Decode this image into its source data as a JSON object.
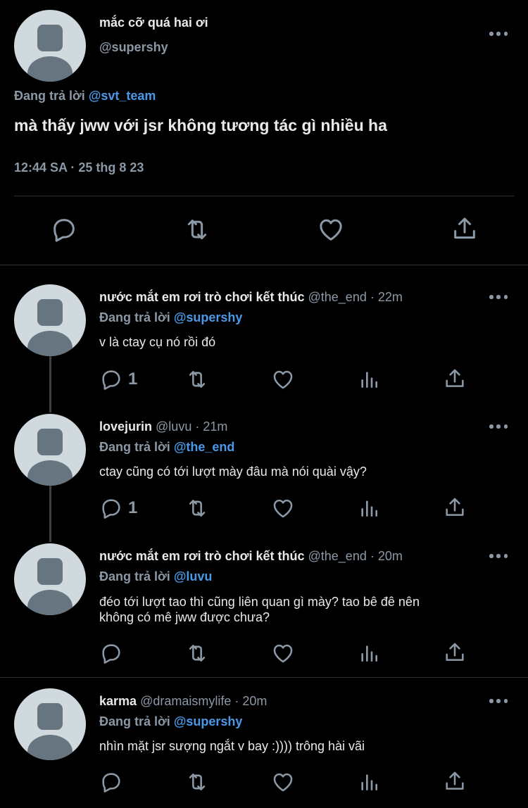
{
  "main_tweet": {
    "display_name": "mắc cỡ quá hai ơi",
    "handle": "@supershy",
    "reply_prefix": "Đang trả lời",
    "reply_to": "@svt_team",
    "text": "mà thấy jww với jsr không tương tác gì nhiều ha",
    "meta": "12:44 SA · 25 thg 8 23"
  },
  "replies": [
    {
      "display_name": "nước mắt em rơi trò chơi kết thúc",
      "handle": "@the_end",
      "time": "· 22m",
      "reply_prefix": "Đang trả lời",
      "reply_to": "@supershy",
      "text": "v là ctay cụ nó rồi đó",
      "reply_count": "1"
    },
    {
      "display_name": "lovejurin",
      "handle": "@luvu",
      "time": "· 21m",
      "reply_prefix": "Đang trả lời",
      "reply_to": "@the_end",
      "text": "ctay cũng có tới lượt mày đâu mà nói quài vậy?",
      "reply_count": "1"
    },
    {
      "display_name": "nước mắt em rơi trò chơi kết thúc",
      "handle": "@the_end",
      "time": "· 20m",
      "reply_prefix": "Đang trả lời",
      "reply_to": "@luvu",
      "text_line1": "đéo tới lượt tao thì cũng liên quan gì mày? tao bê đê nên",
      "text_line2": "không có mê jww được chưa?",
      "reply_count": ""
    },
    {
      "display_name": "karma",
      "handle": "@dramaismylife",
      "time": "· 20m",
      "reply_prefix": "Đang trả lời",
      "reply_to": "@supershy",
      "text": "nhìn mặt jsr sượng ngắt v bay :)))) trông hài vãi",
      "reply_count": ""
    }
  ],
  "icons": {
    "reply": "reply-icon",
    "retweet": "retweet-icon",
    "like": "heart-icon",
    "views": "views-icon",
    "share": "share-icon",
    "more": "more-icon"
  },
  "colors": {
    "background": "#000000",
    "text": "#e7e9ea",
    "secondary": "#8b98a5",
    "link": "#4a99e9",
    "divider": "#2f3336"
  }
}
